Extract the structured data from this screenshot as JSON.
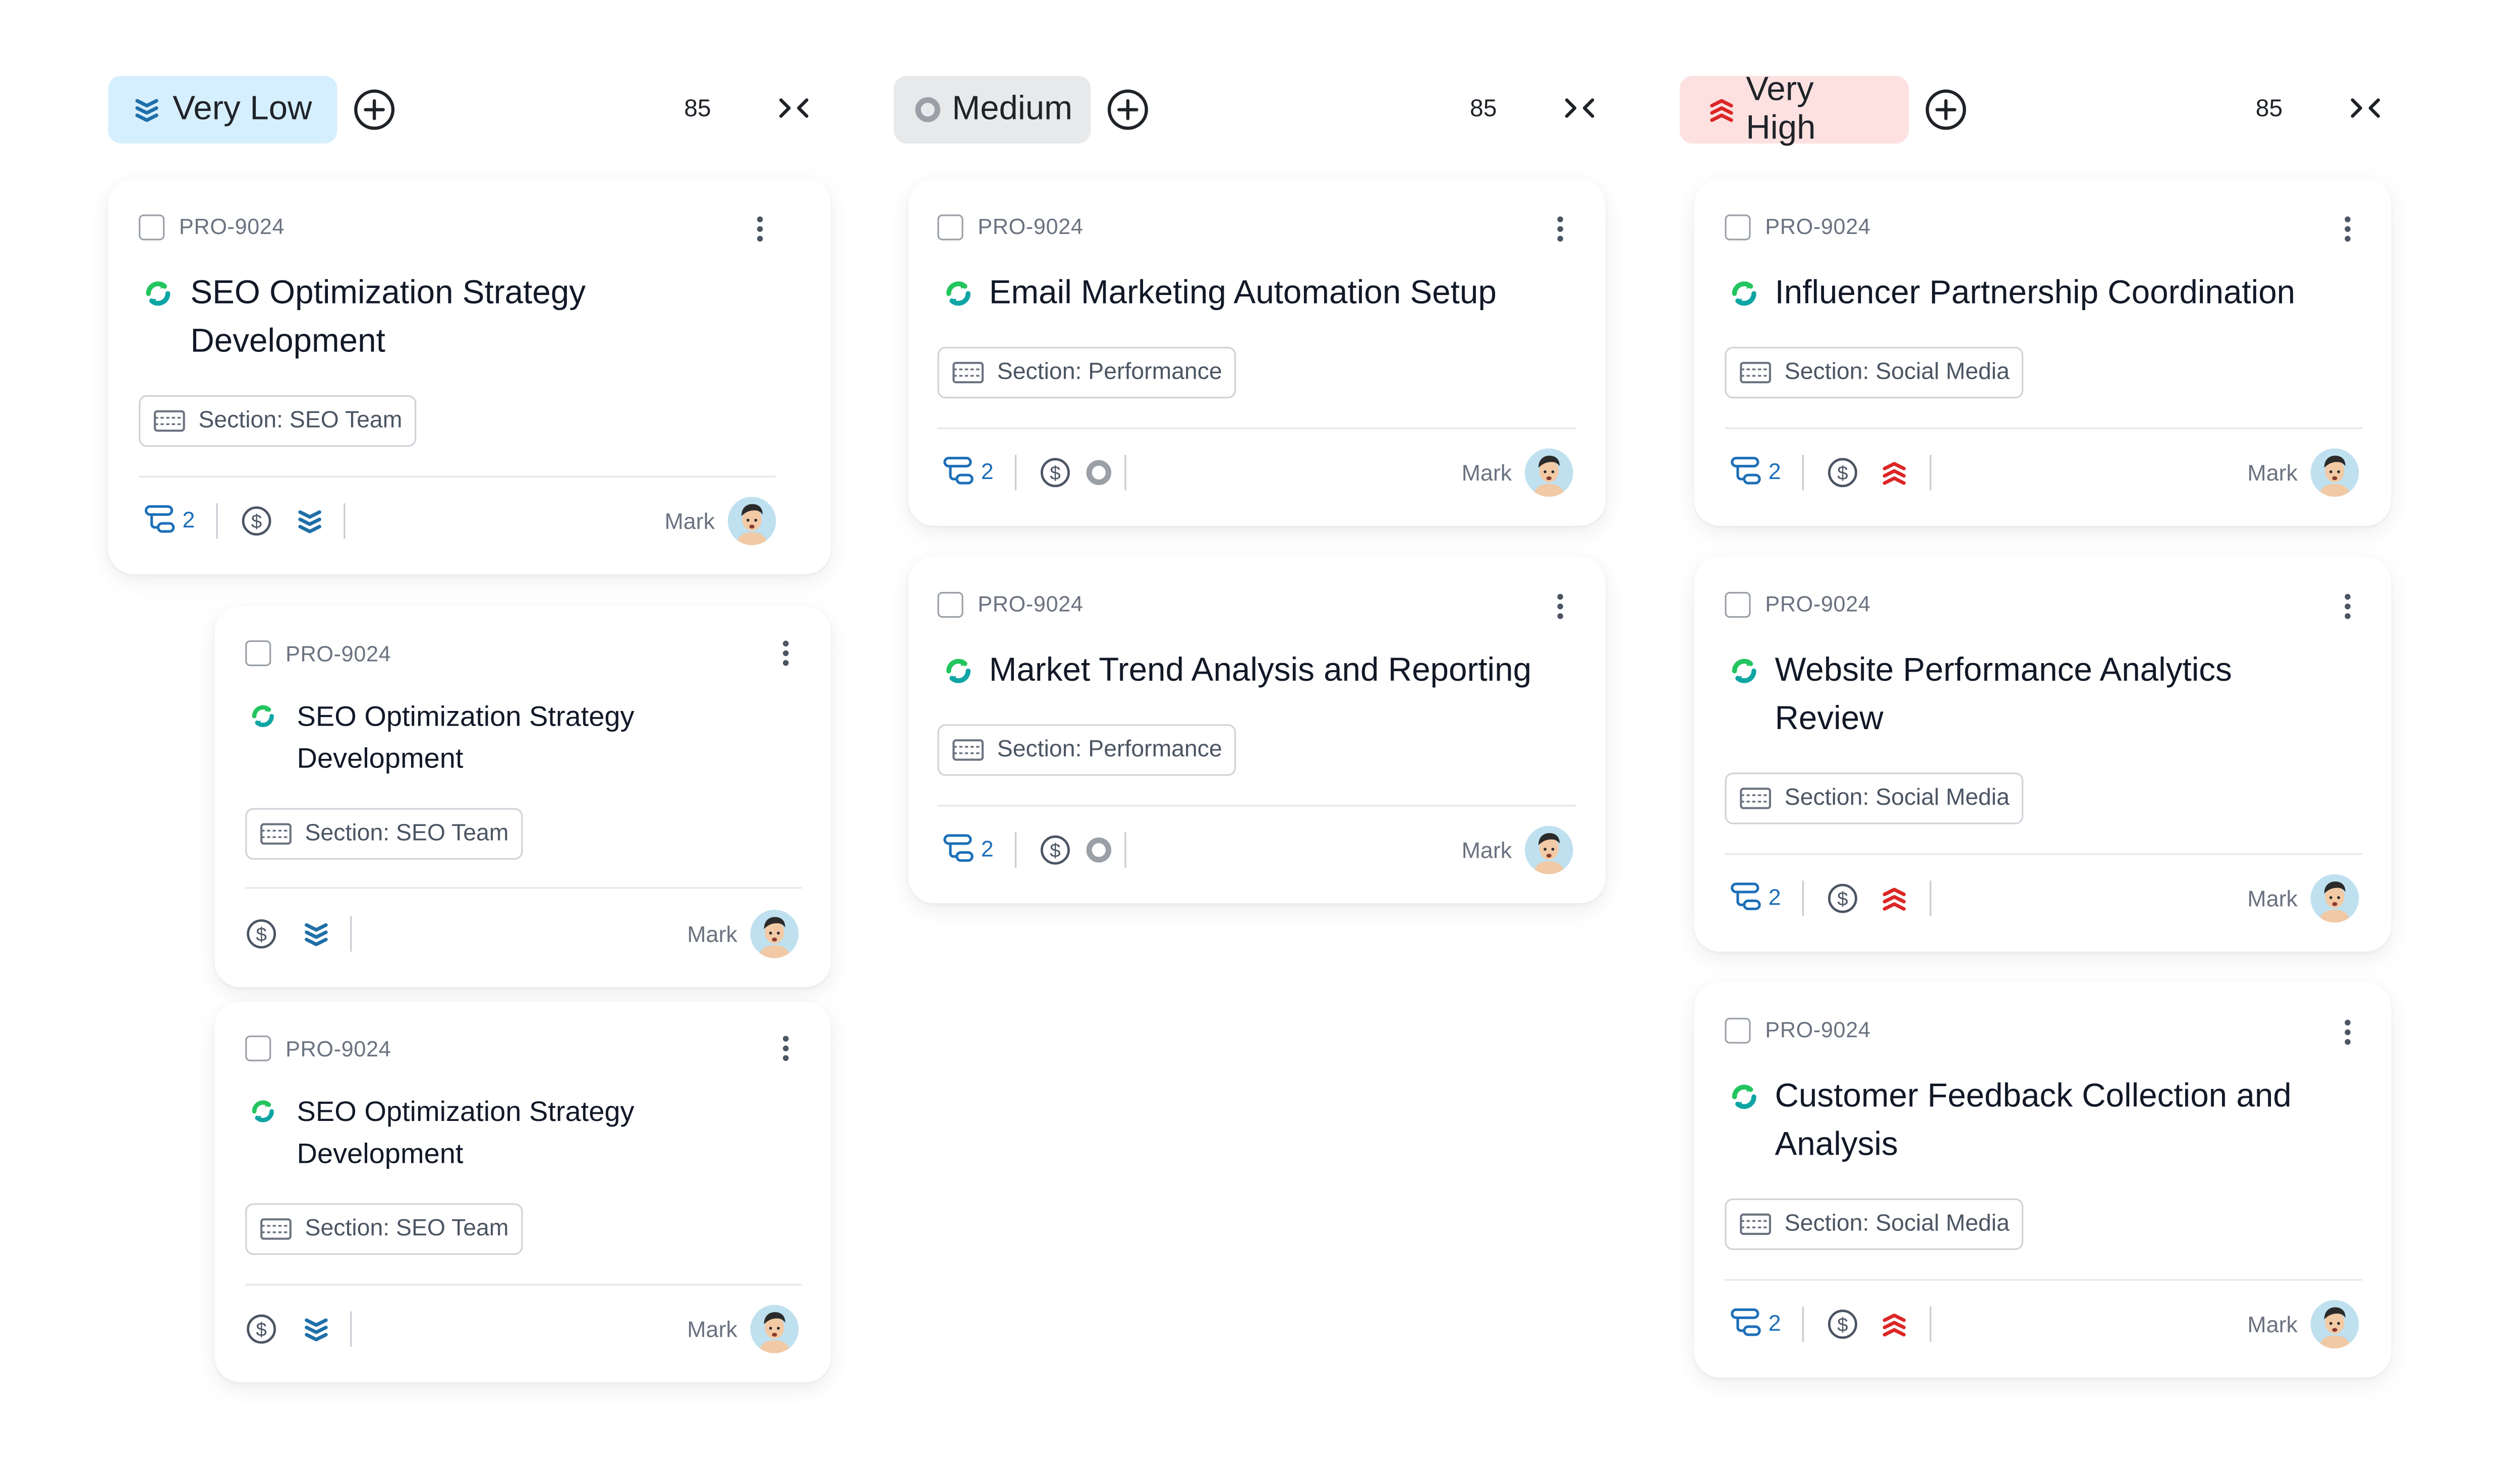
{
  "columns": [
    {
      "label": "Very Low",
      "count": "85",
      "pill_bg": "#d6efff",
      "priority_icon": "chevrons-down-icon"
    },
    {
      "label": "Medium",
      "count": "85",
      "pill_bg": "#e8e9eb",
      "priority_icon": "circle-dot-icon"
    },
    {
      "label": "Very High",
      "count": "85",
      "pill_bg": "#fde1e1",
      "priority_icon": "chevrons-up-icon"
    }
  ],
  "cards": {
    "c1": {
      "id": "PRO-9024",
      "title_line1": "SEO Optimization Strategy",
      "title_line2": "Development",
      "section": "Section: SEO Team",
      "subtasks": "2",
      "owner": "Mark"
    },
    "c2": {
      "id": "PRO-9024",
      "title_line1": "SEO Optimization Strategy",
      "title_line2": "Development",
      "section": "Section: SEO Team",
      "owner": "Mark"
    },
    "c3": {
      "id": "PRO-9024",
      "title_line1": "SEO Optimization Strategy",
      "title_line2": "Development",
      "section": "Section: SEO Team",
      "owner": "Mark"
    },
    "c4": {
      "id": "PRO-9024",
      "title_line1": "Email Marketing Automation Setup",
      "section": "Section: Performance",
      "subtasks": "2",
      "owner": "Mark"
    },
    "c5": {
      "id": "PRO-9024",
      "title_line1": "Market Trend Analysis and Reporting",
      "section": "Section: Performance",
      "subtasks": "2",
      "owner": "Mark"
    },
    "c6": {
      "id": "PRO-9024",
      "title_line1": "Influencer Partnership Coordination",
      "section": "Section: Social Media",
      "subtasks": "2",
      "owner": "Mark"
    },
    "c7": {
      "id": "PRO-9024",
      "title_line1": "Website Performance Analytics",
      "title_line2": "Review",
      "section": "Section: Social Media",
      "subtasks": "2",
      "owner": "Mark"
    },
    "c8": {
      "id": "PRO-9024",
      "title_line1": "Customer Feedback Collection and",
      "title_line2": "Analysis",
      "section": "Section: Social Media",
      "subtasks": "2",
      "owner": "Mark"
    }
  },
  "colors": {
    "subtask_blue": "#1d6fb8",
    "very_low_blue": "#1f6fa8",
    "medium_gray": "#9aa0a6",
    "very_high_red": "#dc2626",
    "sync_green": "#22c55e",
    "sync_teal": "#0ea5a4"
  }
}
